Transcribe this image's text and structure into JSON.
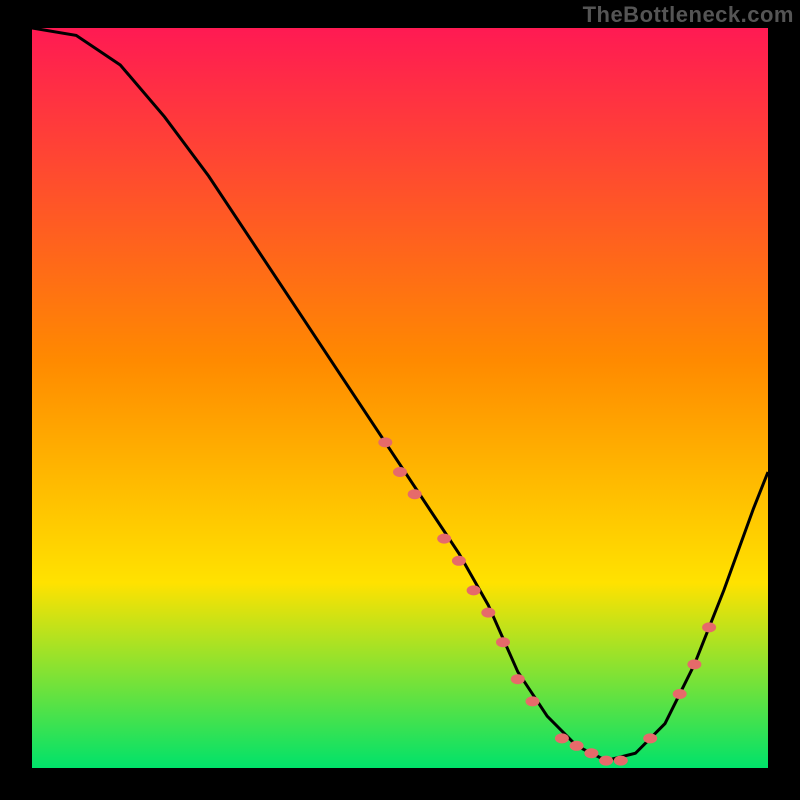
{
  "watermark": "TheBottleneck.com",
  "colors": {
    "frame": "#000000",
    "gradient_top": "#ff1a53",
    "gradient_mid": "#ffd400",
    "gradient_bottom": "#00e26a",
    "curve": "#000000",
    "marker": "#e66a6a"
  },
  "chart_data": {
    "type": "line",
    "title": "",
    "xlabel": "",
    "ylabel": "",
    "xlim": [
      0,
      100
    ],
    "ylim": [
      0,
      100
    ],
    "grid": false,
    "series": [
      {
        "name": "bottleneck-curve",
        "x": [
          0,
          6,
          12,
          18,
          24,
          30,
          36,
          42,
          48,
          54,
          58,
          62,
          66,
          70,
          74,
          78,
          82,
          86,
          90,
          94,
          98,
          100
        ],
        "values": [
          100,
          99,
          95,
          88,
          80,
          71,
          62,
          53,
          44,
          35,
          29,
          22,
          13,
          7,
          3,
          1,
          2,
          6,
          14,
          24,
          35,
          40
        ]
      }
    ],
    "markers": {
      "name": "highlight-points",
      "x": [
        48,
        50,
        52,
        56,
        58,
        60,
        62,
        64,
        66,
        68,
        72,
        74,
        76,
        78,
        80,
        84,
        88,
        90,
        92
      ],
      "values": [
        44,
        40,
        37,
        31,
        28,
        24,
        21,
        17,
        12,
        9,
        4,
        3,
        2,
        1,
        1,
        4,
        10,
        14,
        19
      ]
    }
  }
}
